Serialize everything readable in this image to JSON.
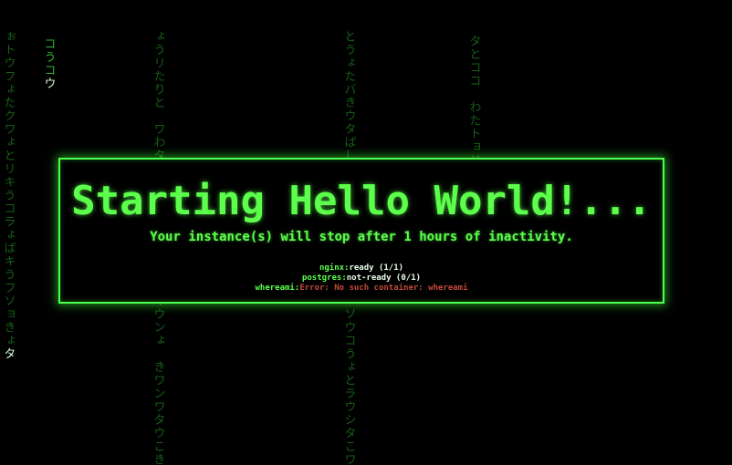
{
  "page": {
    "title": "Starting Hello World!...",
    "subtitle": "Your instance(s) will stop after 1 hours of inactivity."
  },
  "services": [
    {
      "name": "nginx",
      "separator": ":",
      "status": "ready (1/1)",
      "status_type": "ok"
    },
    {
      "name": "postgres",
      "separator": ":",
      "status": "not-ready (0/1)",
      "status_type": "ok"
    },
    {
      "name": "whereami",
      "separator": ":",
      "status": "Error: No such container: whereami",
      "status_type": "error"
    }
  ],
  "rain": [
    {
      "text": "ぉトウフょたクワょとリキうコラょばキうフソョきょ",
      "head": "タ"
    },
    {
      "text": "コうコ",
      "head": "ウ"
    },
    {
      "text": "ょうリたりと　ワわタウラゥラウジたバシヲキウンょ　きワンワタウこき",
      "head": ""
    },
    {
      "text": "とうょたバきウタばしバわウリラウタはリタ　ソウコうょとラウシタこワ",
      "head": ""
    },
    {
      "text": "タとココ　わたトョリョリヲアトうう",
      "head": ""
    }
  ],
  "colors": {
    "accent": "#5cff4c",
    "border": "#4cff4c",
    "rain": "#1f7a1f",
    "error": "#c34a3a",
    "background": "#000000"
  }
}
